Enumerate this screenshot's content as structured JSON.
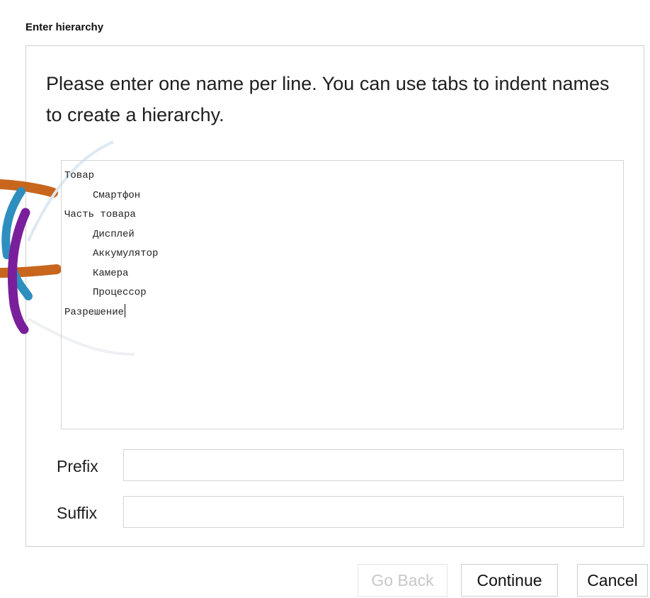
{
  "dialog": {
    "title": "Enter hierarchy",
    "instructions": "Please enter one name per line. You can use tabs to indent names to create a hierarchy."
  },
  "names": {
    "lines": [
      {
        "text": "Товар",
        "indent": false
      },
      {
        "text": "Смартфон",
        "indent": true
      },
      {
        "text": "Часть товара",
        "indent": false
      },
      {
        "text": "Дисплей",
        "indent": true
      },
      {
        "text": "Аккумулятор",
        "indent": true
      },
      {
        "text": "Камера",
        "indent": true
      },
      {
        "text": "Процессор",
        "indent": true
      },
      {
        "text": "Разрешение",
        "indent": false
      }
    ]
  },
  "fields": {
    "prefix_label": "Prefix",
    "prefix_value": "",
    "suffix_label": "Suffix",
    "suffix_value": ""
  },
  "buttons": {
    "go_back": "Go Back",
    "continue": "Continue",
    "cancel": "Cancel"
  },
  "colors": {
    "decor_orange": "#c8661e",
    "decor_blue": "#2e8fbf",
    "decor_purple": "#7a1f9b",
    "disabled_text": "#c8c8c8"
  }
}
